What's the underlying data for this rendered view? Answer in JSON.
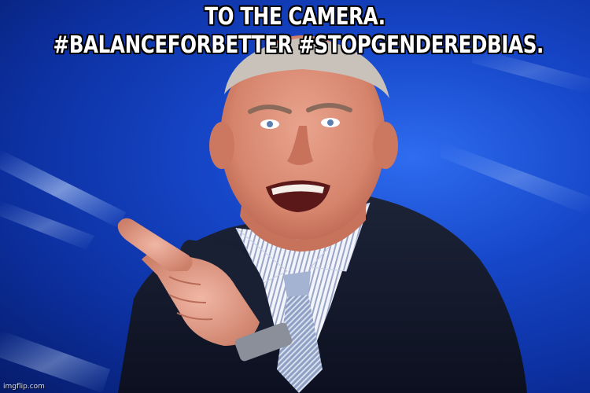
{
  "caption": {
    "line1": "TO THE CAMERA.",
    "line2": "#BALANCEFORBETTER #STOPGENDEREDBIAS."
  },
  "watermark": "imgflip.com",
  "colors": {
    "background": "#1646c8",
    "suit": "#141a2a",
    "skin": "#d98f7a",
    "caption_text": "#ffffff",
    "caption_outline": "#000000"
  }
}
